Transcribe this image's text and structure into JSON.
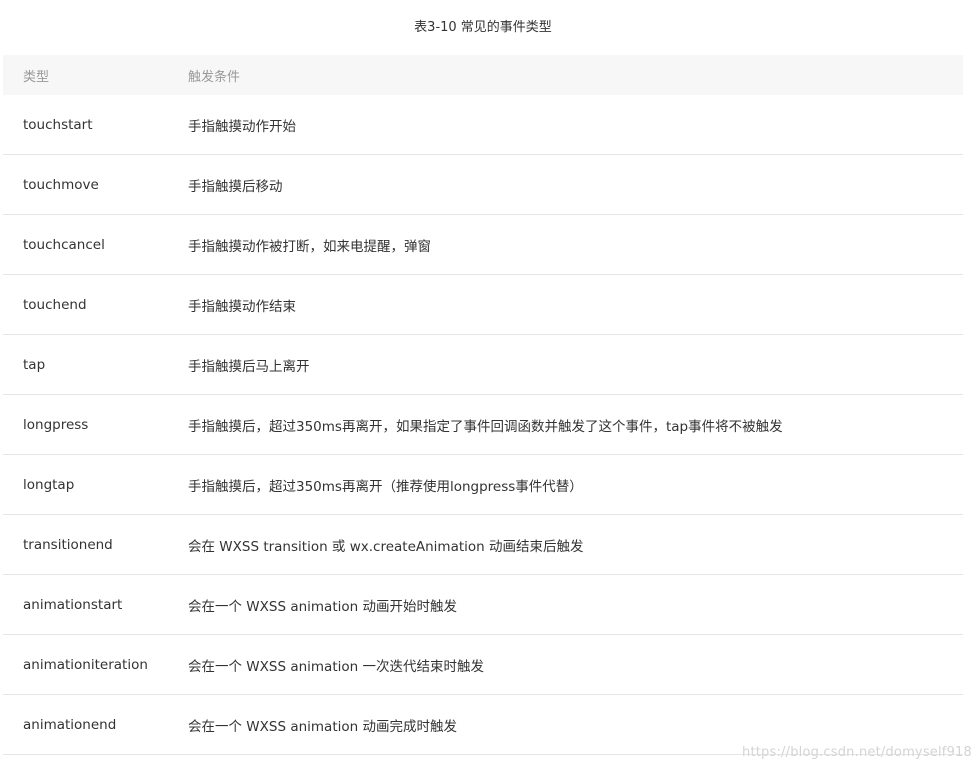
{
  "caption": "表3-10 常见的事件类型",
  "table": {
    "headers": [
      "类型",
      "触发条件"
    ],
    "rows": [
      {
        "type": "touchstart",
        "desc": "手指触摸动作开始"
      },
      {
        "type": "touchmove",
        "desc": "手指触摸后移动"
      },
      {
        "type": "touchcancel",
        "desc": "手指触摸动作被打断，如来电提醒，弹窗"
      },
      {
        "type": "touchend",
        "desc": "手指触摸动作结束"
      },
      {
        "type": "tap",
        "desc": "手指触摸后马上离开"
      },
      {
        "type": "longpress",
        "desc": "手指触摸后，超过350ms再离开，如果指定了事件回调函数并触发了这个事件，tap事件将不被触发"
      },
      {
        "type": "longtap",
        "desc": "手指触摸后，超过350ms再离开（推荐使用longpress事件代替）"
      },
      {
        "type": "transitionend",
        "desc": "会在 WXSS transition 或 wx.createAnimation 动画结束后触发"
      },
      {
        "type": "animationstart",
        "desc": "会在一个 WXSS animation 动画开始时触发"
      },
      {
        "type": "animationiteration",
        "desc": "会在一个 WXSS animation 一次迭代结束时触发"
      },
      {
        "type": "animationend",
        "desc": "会在一个 WXSS animation 动画完成时触发"
      }
    ]
  },
  "watermark": "https://blog.csdn.net/domyself918"
}
